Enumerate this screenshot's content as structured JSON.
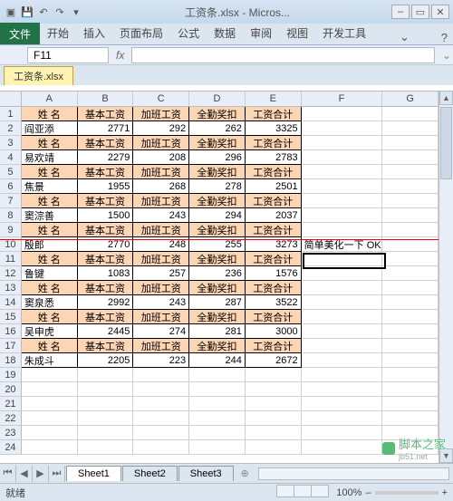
{
  "app": {
    "title": "工资条.xlsx - Micros...",
    "min": "–",
    "max": "▭",
    "close": "✕"
  },
  "ribbon": {
    "file": "文件",
    "tabs": [
      "开始",
      "插入",
      "页面布局",
      "公式",
      "数据",
      "审阅",
      "视图",
      "开发工具"
    ],
    "toggle": "⌄",
    "help": "?"
  },
  "namebox": {
    "cell": "F11",
    "fx": "fx"
  },
  "workbook": {
    "tab": "工资条.xlsx"
  },
  "columns": [
    "A",
    "B",
    "C",
    "D",
    "E",
    "F",
    "G"
  ],
  "headers": {
    "name": "姓 名",
    "base": "基本工资",
    "ot": "加班工资",
    "att": "全勤奖扣",
    "total": "工资合计"
  },
  "rows": [
    {
      "h": true
    },
    {
      "name": "阎亚添",
      "b": 2771,
      "c": 292,
      "d": 262,
      "e": 3325
    },
    {
      "h": true
    },
    {
      "name": "易欢靖",
      "b": 2279,
      "c": 208,
      "d": 296,
      "e": 2783
    },
    {
      "h": true
    },
    {
      "name": "焦景",
      "b": 1955,
      "c": 268,
      "d": 278,
      "e": 2501
    },
    {
      "h": true
    },
    {
      "name": "窦淙善",
      "b": 1500,
      "c": 243,
      "d": 294,
      "e": 2037
    },
    {
      "h": true
    },
    {
      "name": "殷郎",
      "b": 2770,
      "c": 248,
      "d": 255,
      "e": 3273,
      "f": "简单美化一下 OK"
    },
    {
      "h": true
    },
    {
      "name": "鲁键",
      "b": 1083,
      "c": 257,
      "d": 236,
      "e": 1576
    },
    {
      "h": true
    },
    {
      "name": "窦泉悉",
      "b": 2992,
      "c": 243,
      "d": 287,
      "e": 3522
    },
    {
      "h": true
    },
    {
      "name": "吴申虎",
      "b": 2445,
      "c": 274,
      "d": 281,
      "e": 3000
    },
    {
      "h": true
    },
    {
      "name": "朱成斗",
      "b": 2205,
      "c": 223,
      "d": 244,
      "e": 2672
    }
  ],
  "extra_rows": [
    19,
    20,
    21,
    22,
    23,
    24
  ],
  "sheets": {
    "nav": [
      "⏮",
      "◀",
      "▶",
      "⏭"
    ],
    "tabs": [
      "Sheet1",
      "Sheet2",
      "Sheet3"
    ],
    "add": "⊕"
  },
  "status": {
    "ready": "就绪",
    "zoom": "100%",
    "minus": "–",
    "plus": "+"
  },
  "watermark": {
    "text": "脚本之家",
    "url": "jb51.net"
  }
}
